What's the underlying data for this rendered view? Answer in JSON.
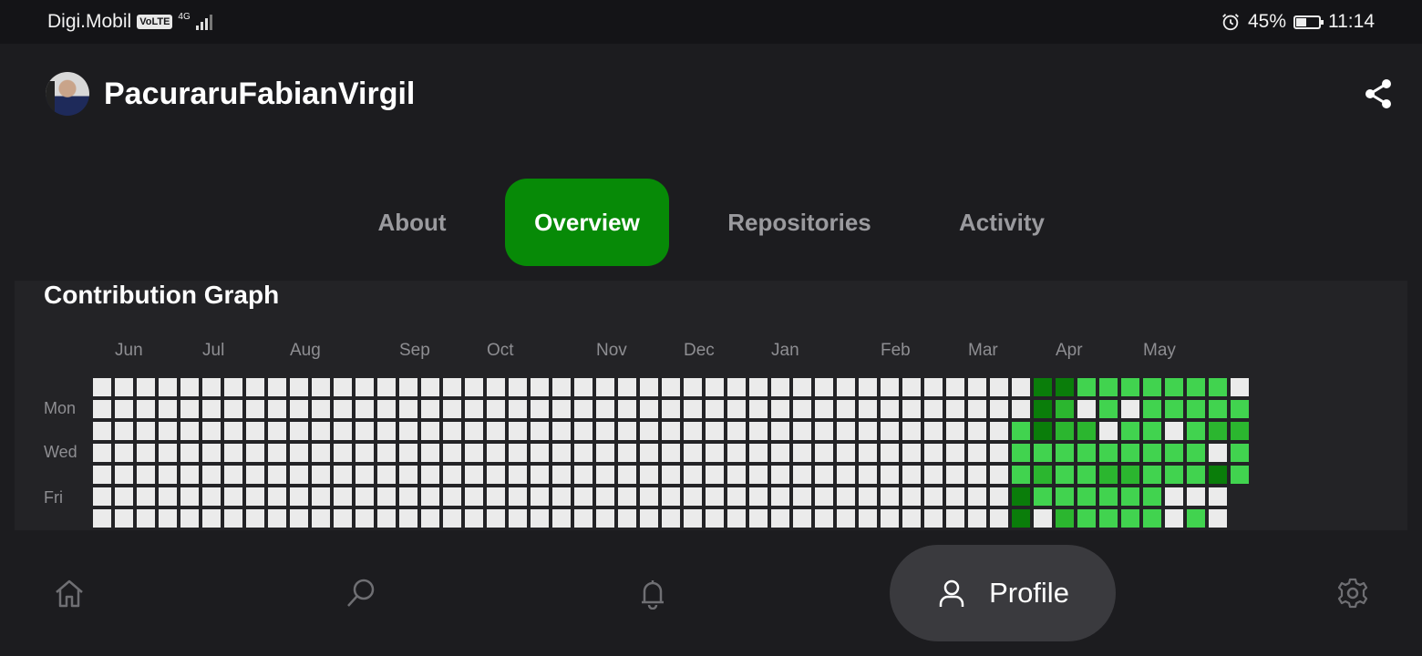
{
  "status_bar": {
    "carrier": "Digi.Mobil",
    "volte": "VoLTE",
    "network": "4G",
    "battery_percent": "45%",
    "battery_level": 0.45,
    "time": "11:14"
  },
  "profile": {
    "username": "PacuraruFabianVirgil"
  },
  "tabs": [
    {
      "label": "About"
    },
    {
      "label": "Overview"
    },
    {
      "label": "Repositories"
    },
    {
      "label": "Activity"
    }
  ],
  "active_tab": "Overview",
  "contribution_graph": {
    "title": "Contribution Graph",
    "months": [
      "Jun",
      "Jul",
      "Aug",
      "Sep",
      "Oct",
      "Nov",
      "Dec",
      "Jan",
      "Feb",
      "Mar",
      "Apr",
      "May"
    ],
    "day_labels": [
      "Mon",
      "Wed",
      "Fri"
    ],
    "colors": {
      "0": "#ebebeb",
      "1": "#41d34f",
      "2": "#2bb62f",
      "3": "#0a7d0a"
    },
    "active_weeks": [
      "0000000",
      "0011133",
      "3331210",
      "3221112",
      "1021111",
      "1101211",
      "1011211",
      "1111111",
      "1101100",
      "1111101",
      "1120300",
      "0121110"
    ]
  },
  "bottom_nav": {
    "items": [
      {
        "icon": "home-icon"
      },
      {
        "icon": "search-icon"
      },
      {
        "icon": "bell-icon"
      },
      {
        "icon": "person-icon",
        "label": "Profile"
      },
      {
        "icon": "gear-icon"
      }
    ]
  }
}
